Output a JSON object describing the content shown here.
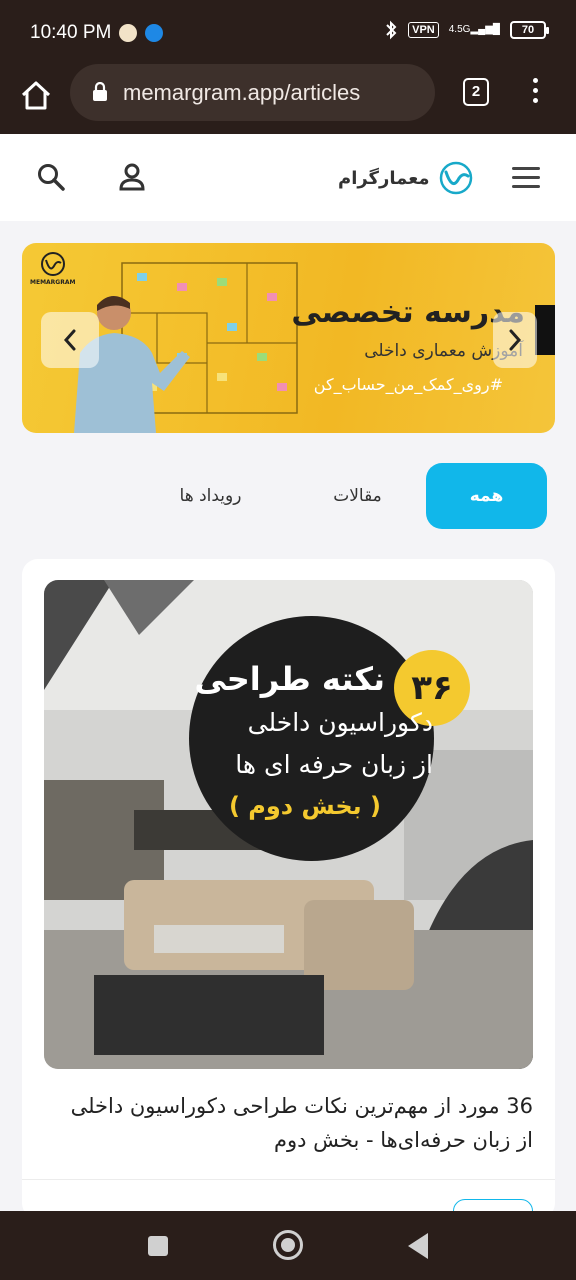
{
  "status_bar": {
    "time": "10:40 PM",
    "vpn": "VPN",
    "network": "4.5G",
    "battery": "70",
    "icons": [
      "notification-icon",
      "phone-call-icon",
      "bluetooth-icon",
      "signal-icon",
      "battery-icon"
    ]
  },
  "browser": {
    "url": "memargram.app/articles",
    "tab_count": "2",
    "icons": [
      "home-icon",
      "lock-icon",
      "menu-dots-icon"
    ]
  },
  "header": {
    "logo_text": "معمارگرام",
    "icons": [
      "search-icon",
      "user-icon",
      "hamburger-icon",
      "logo-icon"
    ]
  },
  "banner": {
    "brand": "MEMARGRAM",
    "title": "مدرسه تخصصی",
    "subtitle": "آموزش معماری داخلی",
    "hashtag": "#روی_کمک_من_حساب_کن",
    "icons": [
      "chevron-left-icon",
      "chevron-right-icon"
    ]
  },
  "filters": {
    "tabs": [
      {
        "label": "همه",
        "active": true
      },
      {
        "label": "مقالات",
        "active": false
      },
      {
        "label": "رویداد ها",
        "active": false
      }
    ]
  },
  "article": {
    "image_number": "۳۶",
    "image_line1": "نکته طراحی",
    "image_line2": "دکوراسیون داخلی",
    "image_line3": "از زبان حرفه ای ها",
    "image_line4": "( بخش دوم )",
    "title_line1": "36 مورد از مهم‌ترین نکات طراحی دکوراسیون داخلی",
    "title_line2": "از زبان حرفه‌ای‌ها - بخش دوم"
  },
  "colors": {
    "accent": "#11b7ea",
    "banner_yellow": "#f2b824",
    "chrome_dark": "#2a1e1a"
  },
  "nav_bar": {
    "icons": [
      "recents-icon",
      "home-circle-icon",
      "back-triangle-icon"
    ]
  }
}
